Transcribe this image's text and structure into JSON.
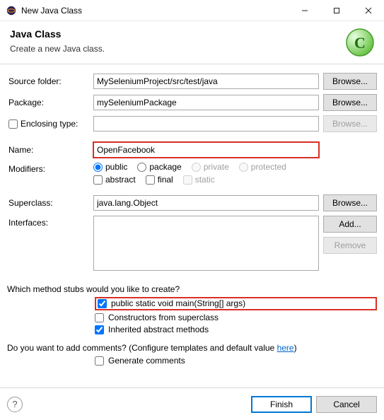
{
  "window": {
    "title": "New Java Class"
  },
  "banner": {
    "heading": "Java Class",
    "sub": "Create a new Java class."
  },
  "labels": {
    "sourceFolder": "Source folder:",
    "package": "Package:",
    "enclosingType": "Enclosing type:",
    "name": "Name:",
    "modifiers": "Modifiers:",
    "superclass": "Superclass:",
    "interfaces": "Interfaces:"
  },
  "fields": {
    "sourceFolder": "MySeleniumProject/src/test/java",
    "package": "mySeleniumPackage",
    "enclosingType": "",
    "name": "OpenFacebook",
    "superclass": "java.lang.Object",
    "interfaces": ""
  },
  "buttons": {
    "browse": "Browse...",
    "add": "Add...",
    "remove": "Remove",
    "finish": "Finish",
    "cancel": "Cancel"
  },
  "modifiers": {
    "public": "public",
    "package": "package",
    "private": "private",
    "protected": "protected",
    "abstract": "abstract",
    "final": "final",
    "static": "static",
    "selected": "public",
    "abstractChecked": false,
    "finalChecked": false
  },
  "stubs": {
    "question": "Which method stubs would you like to create?",
    "main": "public static void main(String[] args)",
    "constructors": "Constructors from superclass",
    "inherited": "Inherited abstract methods",
    "mainChecked": true,
    "constructorsChecked": false,
    "inheritedChecked": true
  },
  "comments": {
    "question_prefix": "Do you want to add comments? (Configure templates and default value ",
    "link": "here",
    "question_suffix": ")",
    "generate": "Generate comments",
    "generateChecked": false
  }
}
